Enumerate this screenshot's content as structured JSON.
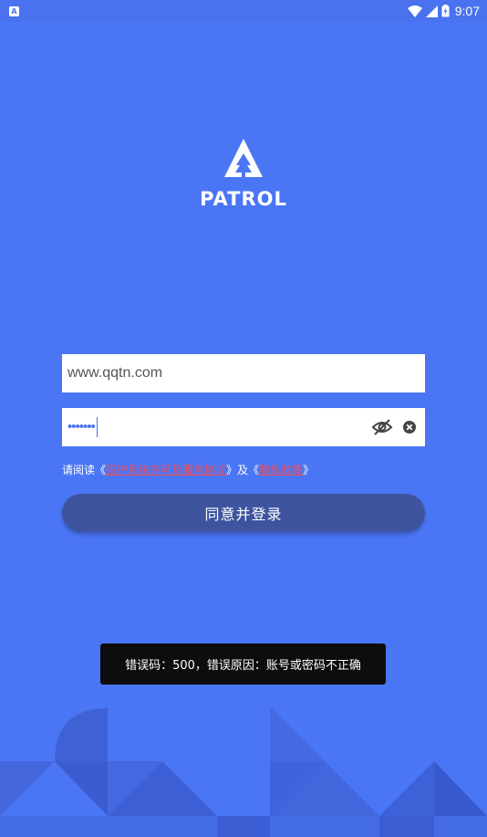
{
  "status_bar": {
    "notification_icon_letter": "A",
    "time": "9:07"
  },
  "logo": {
    "text": "PATROL"
  },
  "login_form": {
    "username_value": "www.qqtn.com",
    "password_value": "•••••••",
    "agreement": {
      "prefix": "请阅读《",
      "link1": "园护系统许可及服务协议",
      "middle": "》及《",
      "link2": "隐私政策",
      "suffix": "》",
      "link_color": "#ea4f5e"
    },
    "submit_label": "同意并登录"
  },
  "toast": {
    "message": "错误码：500，错误原因：账号或密码不正确"
  },
  "colors": {
    "background": "#4a76f5",
    "button": "#3f549f",
    "toast": "#0d0d0d"
  }
}
